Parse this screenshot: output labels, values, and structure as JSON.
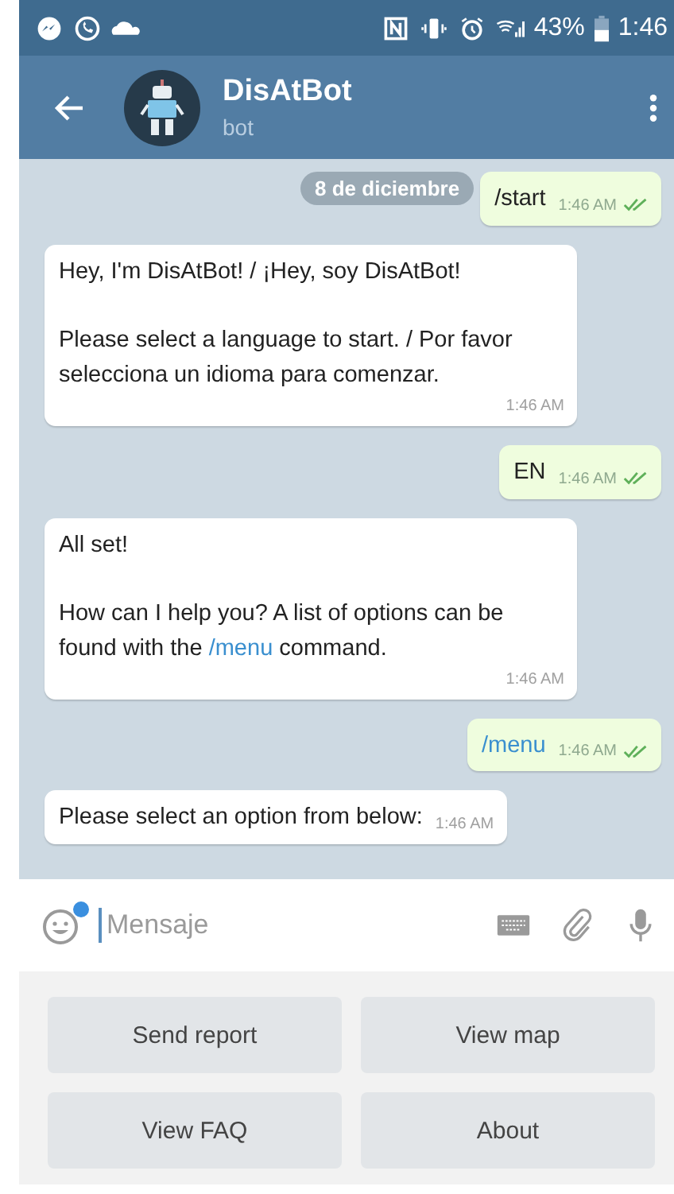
{
  "status_bar": {
    "battery": "43%",
    "time": "1:46"
  },
  "header": {
    "title": "DisAtBot",
    "subtitle": "bot"
  },
  "date_pill": "8 de diciembre",
  "messages": [
    {
      "outgoing": true,
      "parts": [
        {
          "kind": "text",
          "text": "/start"
        }
      ],
      "time": "1:46 AM",
      "read": true
    },
    {
      "outgoing": false,
      "parts": [
        {
          "kind": "text",
          "text": "Hey, I'm DisAtBot! / ¡Hey, soy DisAtBot!\n\nPlease select a language to start. / Por favor selecciona un idioma para comenzar."
        }
      ],
      "time": "1:46 AM"
    },
    {
      "outgoing": true,
      "parts": [
        {
          "kind": "text",
          "text": "EN"
        }
      ],
      "time": "1:46 AM",
      "read": true
    },
    {
      "outgoing": false,
      "parts": [
        {
          "kind": "text",
          "text": "All set!\n\nHow can I help you? A list of options can be found with the "
        },
        {
          "kind": "command",
          "text": "/menu"
        },
        {
          "kind": "text",
          "text": " command."
        }
      ],
      "time": "1:46 AM"
    },
    {
      "outgoing": true,
      "parts": [
        {
          "kind": "command",
          "text": "/menu"
        }
      ],
      "time": "1:46 AM",
      "read": true
    },
    {
      "outgoing": false,
      "parts": [
        {
          "kind": "text",
          "text": "Please select an option from below:"
        }
      ],
      "time": "1:46 AM"
    }
  ],
  "composer": {
    "placeholder": "Mensaje",
    "emoji_badge": true
  },
  "keyboard": [
    [
      "Send report",
      "View map"
    ],
    [
      "View FAQ",
      "About"
    ]
  ]
}
